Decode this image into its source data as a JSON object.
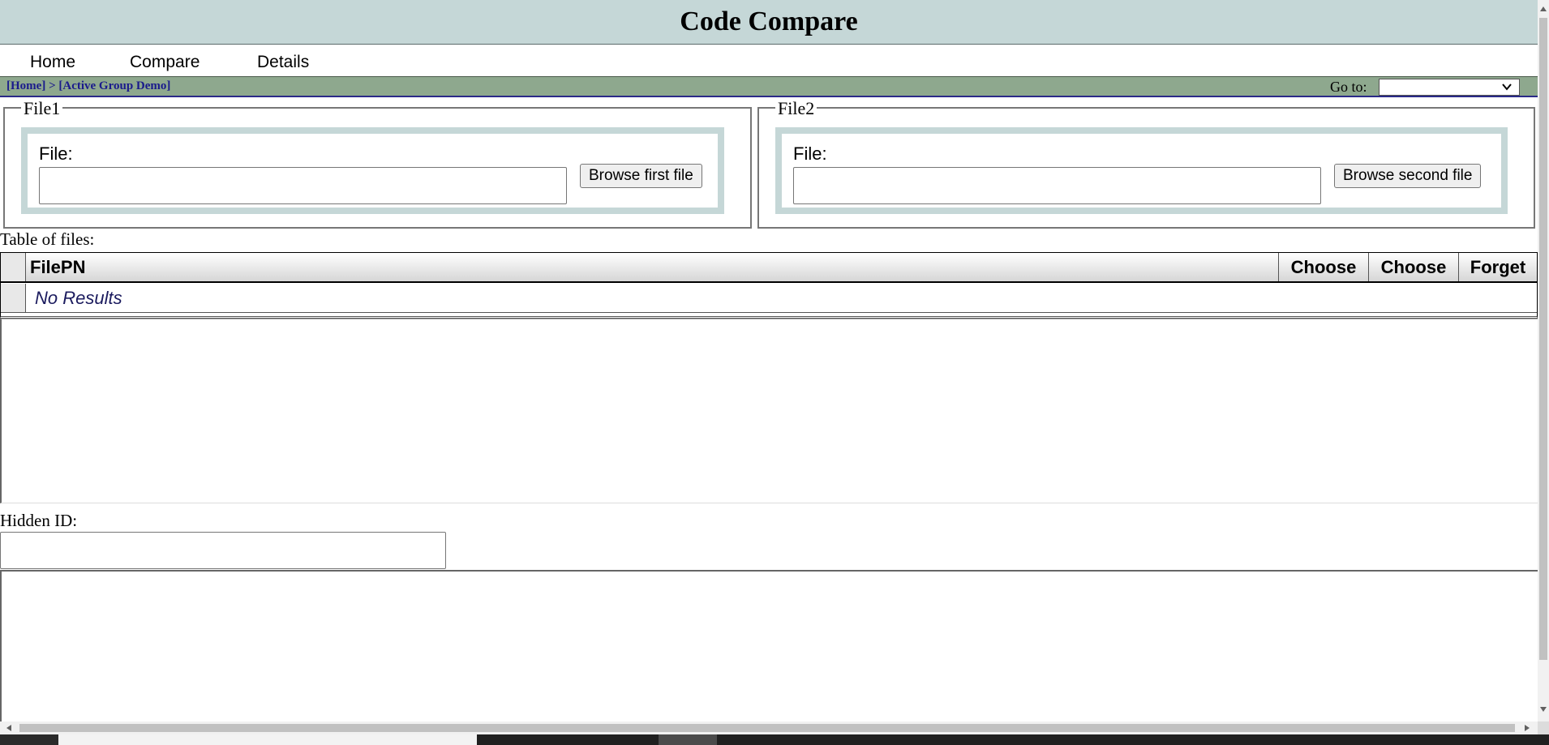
{
  "header": {
    "title": "Code Compare"
  },
  "menu": {
    "items": [
      {
        "label": "Home"
      },
      {
        "label": "Compare"
      },
      {
        "label": "Details"
      }
    ]
  },
  "breadcrumb": {
    "home": "[Home]",
    "separator": ">",
    "current": "[Active Group Demo]"
  },
  "goto": {
    "label": "Go to:",
    "selected": ""
  },
  "file1": {
    "legend": "File1",
    "file_label": "File:",
    "value": "",
    "browse_label": "Browse first file"
  },
  "file2": {
    "legend": "File2",
    "file_label": "File:",
    "value": "",
    "browse_label": "Browse second file"
  },
  "files_table": {
    "caption": "Table of files:",
    "columns": [
      "FilePN",
      "Choose",
      "Choose",
      "Forget"
    ],
    "empty_text": "No Results"
  },
  "hidden_id": {
    "label": "Hidden ID:",
    "value": ""
  },
  "icons": {
    "goto_chevron": "chevron-down-icon",
    "scroll_up": "arrow-up-icon",
    "scroll_down": "arrow-down-icon",
    "scroll_left": "arrow-left-icon",
    "scroll_right": "arrow-right-icon"
  },
  "colors": {
    "title_bar": "#c5d7d7",
    "breadcrumb_bar": "#8ea88e",
    "breadcrumb_text": "#1a1a8c",
    "fieldset_inner_border": "#c5d7d7",
    "no_results_text": "#1b1b5e"
  }
}
